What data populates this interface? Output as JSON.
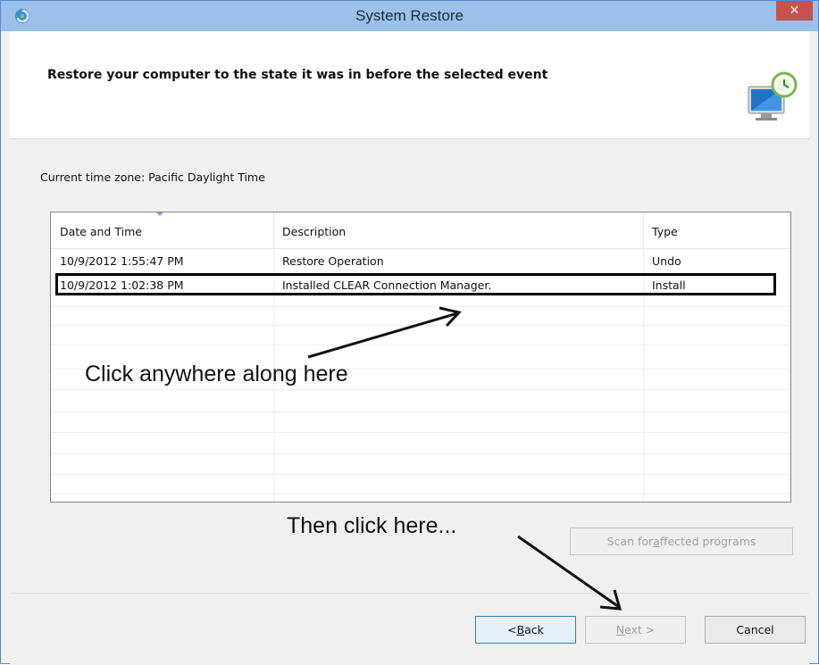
{
  "window": {
    "title": "System Restore",
    "close_label": "✕"
  },
  "header": {
    "heading": "Restore your computer to the state it was in before the selected event"
  },
  "timezone_label": "Current time zone: Pacific Daylight Time",
  "table": {
    "columns": [
      "Date and Time",
      "Description",
      "Type"
    ],
    "rows": [
      {
        "date": "10/9/2012 1:55:47 PM",
        "description": "Restore Operation",
        "type": "Undo"
      },
      {
        "date": "10/9/2012 1:02:38 PM",
        "description": "Installed CLEAR Connection Manager.",
        "type": "Install"
      }
    ]
  },
  "annotations": {
    "row_hint": "Click anywhere along here",
    "button_hint": "Then click here..."
  },
  "buttons": {
    "scan_pre": "Scan for ",
    "scan_acc": "a",
    "scan_post": "ffected programs",
    "back_pre": "< ",
    "back_acc": "B",
    "back_post": "ack",
    "next_acc": "N",
    "next_post": "ext >",
    "cancel": "Cancel"
  },
  "colors": {
    "titlebar": "#9bc0ea",
    "close": "#c75050",
    "highlight_box": "#000000"
  }
}
